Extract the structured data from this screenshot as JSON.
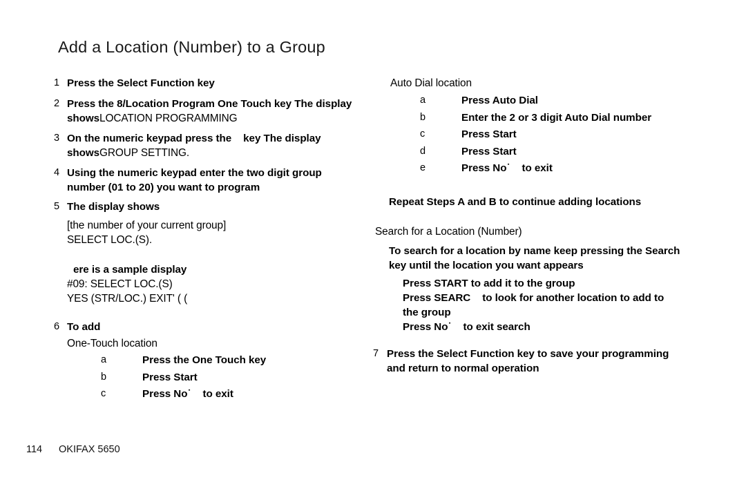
{
  "document": {
    "title": "Add a Location (Number) to a Group"
  },
  "left_column": {
    "steps": [
      {
        "num": "1",
        "text": "Press the Select Function key"
      },
      {
        "num": "2",
        "text": "Press the 8/Location Program One Touch key  The display",
        "cont_bold": "shows",
        "cont_plain": "LOCATION PROGRAMMING"
      },
      {
        "num": "3",
        "text_before_gap": "On the numeric keypad  press the",
        "text_after_gap": "key  The display",
        "cont_bold": "shows",
        "cont_plain": "GROUP SETTING."
      },
      {
        "num": "4",
        "line1": "Using the numeric keypad  enter the two digit group",
        "line2": "number (01 to 20) you want to program"
      },
      {
        "num": "5",
        "text": "The display shows"
      }
    ],
    "display_block": {
      "line1": "[the number of your current group]",
      "line2": "SELECT LOC.(S)."
    },
    "sample": {
      "heading": "ere is a sample display",
      "line1": "#09:  SELECT LOC.(S)",
      "line2": "YES (STR/LOC.) EXIT' (  ("
    },
    "step6": {
      "num": "6",
      "heading": "To add",
      "subheading": "One-Touch location",
      "subitems": [
        {
          "letter": "a",
          "text": "Press the One Touch key"
        },
        {
          "letter": "b",
          "text": "Press Start"
        },
        {
          "letter": "c",
          "text_before_mark": "Press No",
          "text_after_mark": "to exit"
        }
      ]
    }
  },
  "right_column": {
    "auto_dial": {
      "subheading": "Auto Dial location",
      "subitems": [
        {
          "letter": "a",
          "text": "Press Auto Dial"
        },
        {
          "letter": "b",
          "text": "Enter the 2 or 3  digit Auto Dial number"
        },
        {
          "letter": "c",
          "text": "Press Start"
        },
        {
          "letter": "d",
          "text": "Press Start"
        },
        {
          "letter": "e",
          "text_before_mark": "Press No",
          "text_after_mark": "to exit"
        }
      ]
    },
    "repeat_note": "Repeat Steps A and B to continue adding locations",
    "search": {
      "subheading": "Search for a Location (Number)",
      "intro_line1": "To search for a location by name  keep pressing the Search",
      "intro_line2": "key until the location you want appears",
      "actions": {
        "start": "Press START to add it to the group",
        "search_before_gap": "Press SEARC",
        "search_after_gap": "to look for another location to add to",
        "search_line2": "the group",
        "no_before_mark": "Press No",
        "no_after_mark": "to exit search"
      }
    },
    "step7": {
      "num": "7",
      "line1": "Press the Select Function key to save your programming",
      "line2": "and return to normal operation"
    }
  },
  "footer": {
    "page_number": "114",
    "model": "OKIFAX 5650"
  }
}
